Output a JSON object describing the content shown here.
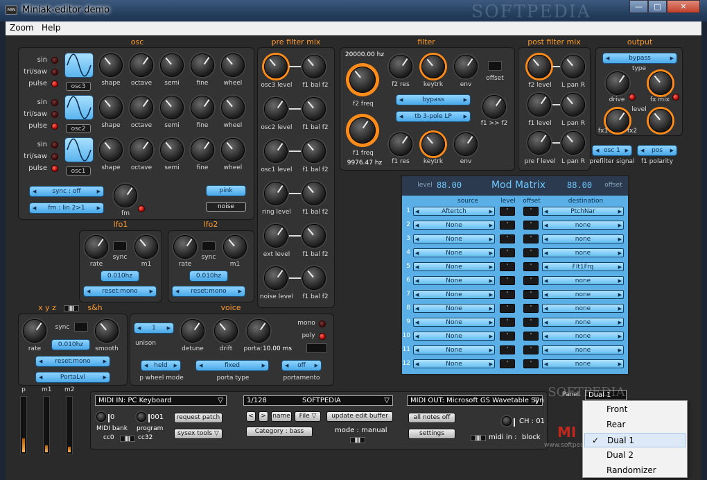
{
  "window": {
    "title": "Miniak-editor demo",
    "icon": "MIN",
    "watermark": "SOFTPEDIA",
    "min": "—",
    "max": "□",
    "close": "✕"
  },
  "menu": [
    "Zoom",
    "Help"
  ],
  "sections": {
    "osc": "osc",
    "pre": "pre filter mix",
    "filter": "filter",
    "post": "post filter mix",
    "output": "output",
    "lfo1": "lfo1",
    "lfo2": "lfo2",
    "xyz": "x y z",
    "sh": "s&h",
    "voice": "voice"
  },
  "osc": {
    "leds": [
      "sin",
      "tri/saw",
      "pulse"
    ],
    "knobs": [
      "shape",
      "octave",
      "semi",
      "fine",
      "wheel"
    ],
    "names": [
      "osc3",
      "osc2",
      "osc1"
    ],
    "sync": "sync : off",
    "fm_sel": "fm : lin 2>1",
    "fm": "fm",
    "pink": "pink",
    "noise": "noise"
  },
  "pre": {
    "rows": [
      [
        "osc3 level",
        "f1 bal f2"
      ],
      [
        "osc2 level",
        "f1 bal f2"
      ],
      [
        "osc1 level",
        "f1 bal f2"
      ],
      [
        "ring level",
        "f1 bal f2"
      ],
      [
        "ext level",
        "f1 bal f2"
      ],
      [
        "noise level",
        "f1 bal f2"
      ]
    ]
  },
  "filter": {
    "f2hz": "20000.00 hz",
    "f2freq": "f2 freq",
    "f2res": "f2 res",
    "keytrk": "keytrk",
    "env": "env",
    "offset": "offset",
    "bypass": "bypass",
    "type": "tb 3-pole LP",
    "f1f2": "f1 >> f2",
    "f1freq": "f1 freq",
    "f1hz": "9976.47 hz",
    "f1res": "f1 res",
    "keytrk2": "keytrk",
    "env2": "env"
  },
  "post": {
    "rows": [
      [
        "f2 level",
        "L pan R"
      ],
      [
        "f1 level",
        "L pan R"
      ],
      [
        "pre f level",
        "L pan R"
      ]
    ],
    "sig_sel": "osc 1",
    "sig": "prefilter signal"
  },
  "output": {
    "bypass": "bypass",
    "type": "type",
    "drive": "drive",
    "fxmix": "fx mix",
    "level": "level",
    "fx1": "fx1",
    "fx2": "fx2",
    "pol_sel": "pos",
    "pol": "f1 polarity"
  },
  "lfo": {
    "rate": "rate",
    "sync": "sync",
    "m1": "m1",
    "hz": "0.010hz",
    "reset": "reset:mono"
  },
  "sh": {
    "rate": "rate",
    "sync": "sync",
    "smooth": "smooth",
    "hz": "0.010hz",
    "reset": "reset:mono",
    "porta": "PortaLvl"
  },
  "voice": {
    "unison_val": "1",
    "unison": "unison",
    "detune": "detune",
    "drift": "drift",
    "porta": "porta:",
    "porta_ms": "10.00 ms",
    "mono": "mono",
    "poly": "poly",
    "held": "held",
    "pwheel": "p wheel mode",
    "fixed": "fixed",
    "ptype": "porta type",
    "off": "off",
    "portamento": "portamento"
  },
  "modmatrix": {
    "title": "Mod Matrix",
    "level": "level",
    "offset": "offset",
    "digits": "88.00",
    "headers": [
      "source",
      "level",
      "offset",
      "destination"
    ],
    "rows": [
      [
        "1",
        "Aftertch",
        "PtchNar"
      ],
      [
        "2",
        "None",
        "none"
      ],
      [
        "3",
        "None",
        "none"
      ],
      [
        "4",
        "None",
        "none"
      ],
      [
        "5",
        "None",
        "Flt1Frq"
      ],
      [
        "6",
        "None",
        "none"
      ],
      [
        "7",
        "None",
        "none"
      ],
      [
        "8",
        "None",
        "none"
      ],
      [
        "9",
        "None",
        "none"
      ],
      [
        "10",
        "None",
        "none"
      ],
      [
        "11",
        "None",
        "none"
      ],
      [
        "12",
        "None",
        "none"
      ]
    ]
  },
  "bottom": {
    "p": "p",
    "m1": "m1",
    "m2": "m2",
    "slider_levels": [
      0.25,
      0.12,
      0.1
    ],
    "midi_in": "MIDI IN: PC Keyboard",
    "bank_val": "0",
    "bank": "MIDI bank",
    "prog_val": "001",
    "program": "program",
    "cc0": "cc0",
    "cc32": "cc32",
    "req": "request patch",
    "sysex": "sysex tools ▽",
    "patch_num": "1/128",
    "patch_name": "SOFTPEDIA",
    "prev": "<",
    "next": ">",
    "name": "name",
    "file": "File ▽",
    "update": "update edit buffer",
    "category": "Category : bass",
    "mode": "mode : manual",
    "midi_out": "MIDI OUT: Microsoft GS Wavetable Syn",
    "notes_off": "all notes off",
    "settings": "settings",
    "ch": "CH : 01",
    "midi_in_lbl": "midi in :",
    "block": "block",
    "panel": "Panel",
    "panel_sel": "Dual 1",
    "brand": "MI",
    "wm2": "SOFTPEDIA",
    "wm3": "www.softpedia.com"
  },
  "context_menu": {
    "items": [
      "Front",
      "Rear",
      "Dual 1",
      "Dual 2",
      "Randomizer"
    ],
    "selected": "Dual 1",
    "check": "✓"
  }
}
